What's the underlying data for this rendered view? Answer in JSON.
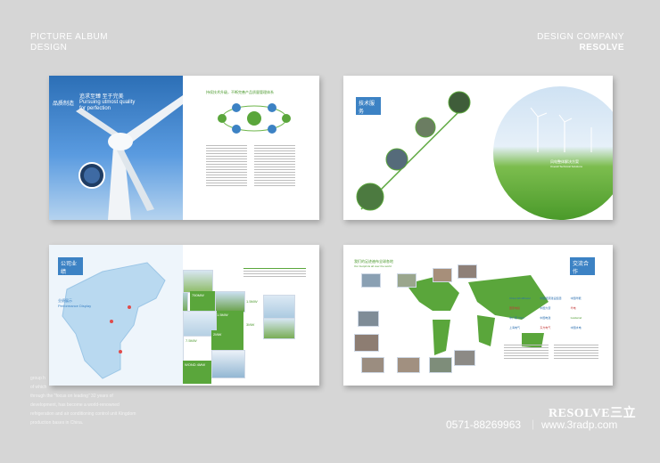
{
  "header_left": {
    "line1": "PICTURE ALBUM",
    "line2": "DESIGN"
  },
  "header_right": {
    "line1": "DESIGN COMPANY",
    "line2": "RESOLVE"
  },
  "spread1": {
    "left_title_cn": "追求至臻 至于完美",
    "left_title_en": "Pursuing utmost quality for perfection",
    "left_tag": "品质制造",
    "right_heading": "持续技术升级，不断完善产品质量管理体系"
  },
  "spread2": {
    "tag": "技术服务",
    "right_caption_cn": "风电整体解决方案",
    "right_caption_en": "Overall Technical Solutions"
  },
  "spread3": {
    "tag": "公司业绩",
    "map_label": "Performance Display",
    "map_label_cn": "业绩展示",
    "figures": [
      "750MW",
      "1.5MW",
      "7.5MW",
      "2MW",
      "1.5MW",
      "3MW",
      "WOND 4MW"
    ]
  },
  "spread4": {
    "heading": "我们的足迹遍布全球各地",
    "subheading": "Our footprints all over the world",
    "tag": "交流合作",
    "partners": [
      "China WindPower",
      "中国能源建设集团",
      "中国华能",
      "国家电投",
      "中国大唐",
      "华电",
      "中广核 CGN",
      "中国电建",
      "Goldwind",
      "上海电气",
      "东方电气",
      "中国水电"
    ]
  },
  "bottom_text": {
    "line1": "group h",
    "line2": "of which",
    "line3": "through the \"focus on leading\" 32 years of",
    "line4": "development, has become a world-renowned",
    "line5": "refrigeration and air conditioning control unit Kingdom",
    "line6": "production bases in China."
  },
  "footer": {
    "brand": "RESOLVE三立",
    "phone": "0571-88269963",
    "separator": "|",
    "website": "www.3radp.com"
  }
}
